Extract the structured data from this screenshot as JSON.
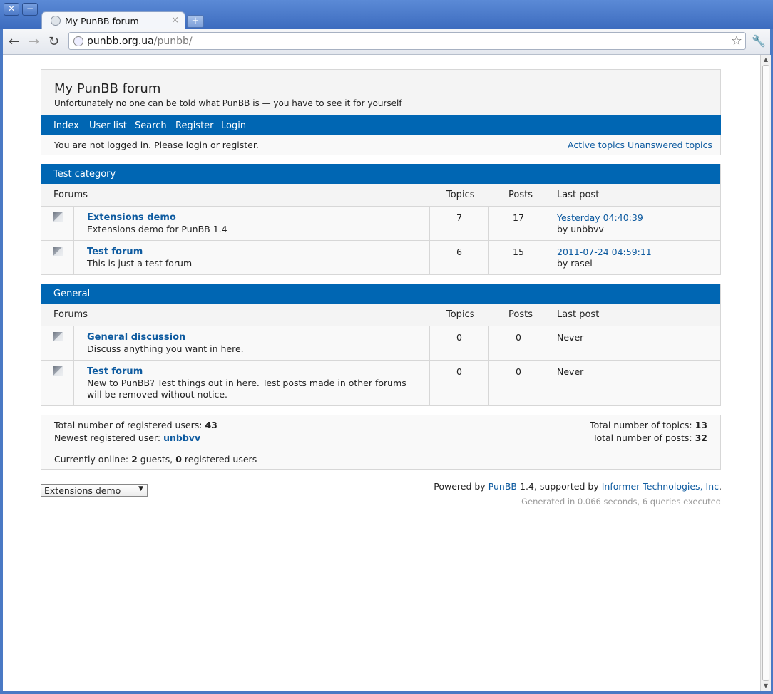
{
  "window": {
    "tab_title": "My PunBB forum",
    "close_glyph": "✕",
    "minimize_glyph": "−",
    "tab_close_glyph": "×",
    "new_tab_glyph": "+"
  },
  "toolbar": {
    "url_host": "punbb.org.ua",
    "url_path": "/punbb/",
    "back_glyph": "←",
    "forward_glyph": "→",
    "reload_glyph": "↻",
    "star_glyph": "☆",
    "wrench_glyph": "🔧"
  },
  "forum": {
    "title": "My PunBB forum",
    "description": "Unfortunately no one can be told what PunBB is — you have to see it for yourself",
    "nav": [
      "Index",
      "User list",
      "Search",
      "Register",
      "Login"
    ],
    "status_message": "You are not logged in. Please login or register.",
    "status_links": [
      "Active topics",
      "Unanswered topics"
    ]
  },
  "columns": {
    "forums": "Forums",
    "topics": "Topics",
    "posts": "Posts",
    "last_post": "Last post"
  },
  "categories": [
    {
      "name": "Test category",
      "forums": [
        {
          "name": "Extensions demo",
          "desc": "Extensions demo for PunBB 1.4",
          "topics": "7",
          "posts": "17",
          "last_post": "Yesterday 04:40:39",
          "last_by": "by unbbvv"
        },
        {
          "name": "Test forum",
          "desc": "This is just a test forum",
          "topics": "6",
          "posts": "15",
          "last_post": "2011-07-24 04:59:11",
          "last_by": "by rasel"
        }
      ]
    },
    {
      "name": "General",
      "forums": [
        {
          "name": "General discussion",
          "desc": "Discuss anything you want in here.",
          "topics": "0",
          "posts": "0",
          "last_post": "Never",
          "last_by": ""
        },
        {
          "name": "Test forum",
          "desc": "New to PunBB? Test things out in here. Test posts made in other forums will be removed without notice.",
          "topics": "0",
          "posts": "0",
          "last_post": "Never",
          "last_by": ""
        }
      ]
    }
  ],
  "stats": {
    "users_label": "Total number of registered users: ",
    "users_value": "43",
    "newest_label": "Newest registered user: ",
    "newest_value": "unbbvv",
    "topics_label": "Total number of topics: ",
    "topics_value": "13",
    "posts_label": "Total number of posts: ",
    "posts_value": "32",
    "online_label": "Currently online: ",
    "online_guests": "2",
    "online_guests_label": " guests, ",
    "online_registered": "0",
    "online_registered_label": " registered users"
  },
  "footer": {
    "jump_selected": "Extensions demo",
    "jump_arrow": "▼",
    "powered_prefix": "Powered by ",
    "powered_link": "PunBB",
    "powered_mid": " 1.4, supported by ",
    "powered_link2": "Informer Technologies, Inc",
    "powered_suffix": ".",
    "generated": "Generated in 0.066 seconds, 6 queries executed"
  }
}
